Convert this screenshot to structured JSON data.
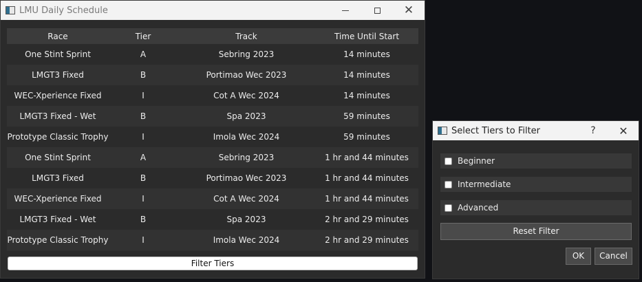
{
  "main_window": {
    "title": "LMU Daily Schedule",
    "controls": {
      "minimize": "—",
      "maximize": "□",
      "close": "✕"
    },
    "table": {
      "columns": [
        "Race",
        "Tier",
        "Track",
        "Time Until Start"
      ],
      "rows": [
        [
          "One Stint Sprint",
          "A",
          "Sebring 2023",
          "14 minutes"
        ],
        [
          "LMGT3 Fixed",
          "B",
          "Portimao Wec 2023",
          "14 minutes"
        ],
        [
          "WEC-Xperience Fixed",
          "I",
          "Cot A Wec 2024",
          "14 minutes"
        ],
        [
          "LMGT3 Fixed - Wet",
          "B",
          "Spa 2023",
          "59 minutes"
        ],
        [
          "Prototype Classic Trophy",
          "I",
          "Imola Wec 2024",
          "59 minutes"
        ],
        [
          "One Stint Sprint",
          "A",
          "Sebring 2023",
          "1 hr and 44 minutes"
        ],
        [
          "LMGT3 Fixed",
          "B",
          "Portimao Wec 2023",
          "1 hr and 44 minutes"
        ],
        [
          "WEC-Xperience Fixed",
          "I",
          "Cot A Wec 2024",
          "1 hr and 44 minutes"
        ],
        [
          "LMGT3 Fixed - Wet",
          "B",
          "Spa 2023",
          "2 hr and 29 minutes"
        ],
        [
          "Prototype Classic Trophy",
          "I",
          "Imola Wec 2024",
          "2 hr and 29 minutes"
        ]
      ]
    },
    "filter_button": "Filter Tiers"
  },
  "dialog": {
    "title": "Select Tiers to Filter",
    "help": "?",
    "close": "✕",
    "options": [
      {
        "label": "Beginner",
        "checked": false
      },
      {
        "label": "Intermediate",
        "checked": false
      },
      {
        "label": "Advanced",
        "checked": false
      }
    ],
    "reset_button": "Reset Filter",
    "ok_button": "OK",
    "cancel_button": "Cancel"
  }
}
